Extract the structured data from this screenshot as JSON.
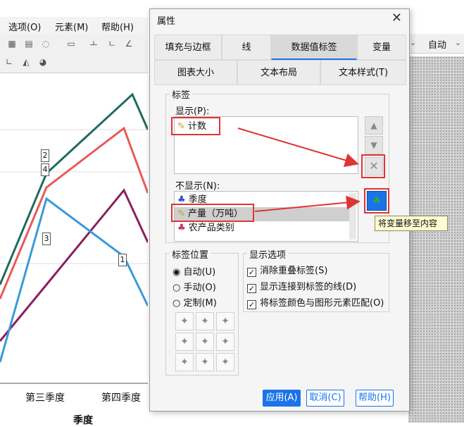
{
  "app": {
    "menu": [
      "选项(O)",
      "元素(M)",
      "帮助(H)"
    ],
    "right_dropdown": "自动"
  },
  "chart": {
    "x_ticks": [
      "第三季度",
      "第四季度"
    ],
    "x_title": "季度",
    "data_labels": [
      "2",
      "4",
      "3",
      "1"
    ]
  },
  "chart_data": {
    "type": "line",
    "categories": [
      "第三季度",
      "第四季度"
    ],
    "xlabel": "季度",
    "series": [
      {
        "color": "#1e6b61",
        "values": [
          2,
          1
        ]
      },
      {
        "color": "#e85a5a",
        "values": [
          4,
          1
        ]
      },
      {
        "color": "#8b1f5e",
        "values": [
          3,
          1
        ]
      },
      {
        "color": "#3a9ad9",
        "values": [
          3,
          1
        ]
      }
    ]
  },
  "dialog": {
    "title": "属性",
    "tabs_row1": [
      "填充与边框",
      "线",
      "数据值标签",
      "变量"
    ],
    "tabs_row2": [
      "图表大小",
      "文本布局",
      "文本样式(T)"
    ],
    "active_tab": "数据值标签",
    "labels_group": "标签",
    "display_label": "显示(P):",
    "display_items": [
      "计数"
    ],
    "hide_label": "不显示(N):",
    "hide_items": [
      "季度",
      "产量（万吨）",
      "农产品类别"
    ],
    "selected_hide_item": "产量（万吨）",
    "tooltip": "将变量移至内容",
    "position_group": "标签位置",
    "position_options": [
      "自动(U)",
      "手动(O)",
      "定制(M)"
    ],
    "position_selected": "自动(U)",
    "display_options_group": "显示选项",
    "display_options": [
      "消除重叠标签(S)",
      "显示连接到标签的线(D)",
      "将标签颜色与图形元素匹配(O)"
    ],
    "buttons": {
      "apply": "应用(A)",
      "cancel": "取消(C)",
      "help": "帮助(H)"
    },
    "accent": "#1a73e8",
    "highlight_red": "#e03434"
  }
}
